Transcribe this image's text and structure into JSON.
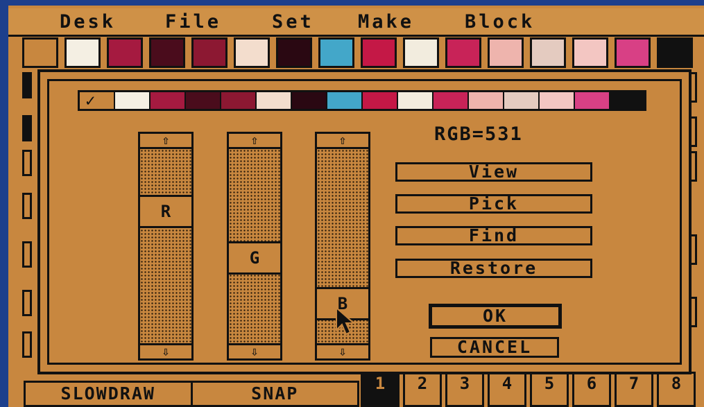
{
  "menu": {
    "items": [
      {
        "label": "Desk"
      },
      {
        "label": "File"
      },
      {
        "label": "Set"
      },
      {
        "label": "Make"
      },
      {
        "label": "Block"
      }
    ]
  },
  "palette": {
    "colors": [
      "#c8873f",
      "#f4efe3",
      "#a51a40",
      "#4a0c1c",
      "#8c1832",
      "#f3ddcd",
      "#2a0812",
      "#43a7c9",
      "#c41846",
      "#f2ecde",
      "#c82358",
      "#eeb4ad",
      "#e4cbc0",
      "#f3c6c2",
      "#d84085",
      "#111111"
    ]
  },
  "dialog": {
    "swatches": [
      "#c8873f",
      "#f4efe3",
      "#a51a40",
      "#4a0c1c",
      "#8c1832",
      "#f3ddcd",
      "#2a0812",
      "#43a7c9",
      "#c41846",
      "#f2ecde",
      "#c82358",
      "#eeb4ad",
      "#e4cbc0",
      "#f3c6c2",
      "#d84085",
      "#111111"
    ],
    "check_icon": "✓",
    "rgb_label": "RGB=531",
    "sliders": [
      {
        "label": "R",
        "level": 5
      },
      {
        "label": "G",
        "level": 3
      },
      {
        "label": "B",
        "level": 1
      }
    ],
    "up_icon": "⇧",
    "down_icon": "⇩",
    "buttons": {
      "view": "View",
      "pick": "Pick",
      "find": "Find",
      "restore": "Restore",
      "ok": "OK",
      "cancel": "CANCEL"
    }
  },
  "status": {
    "slowdraw": "SLOWDRAW",
    "snap": "SNAP"
  },
  "pages": [
    "1",
    "2",
    "3",
    "4",
    "5",
    "6",
    "7",
    "8"
  ],
  "active_page": "1"
}
